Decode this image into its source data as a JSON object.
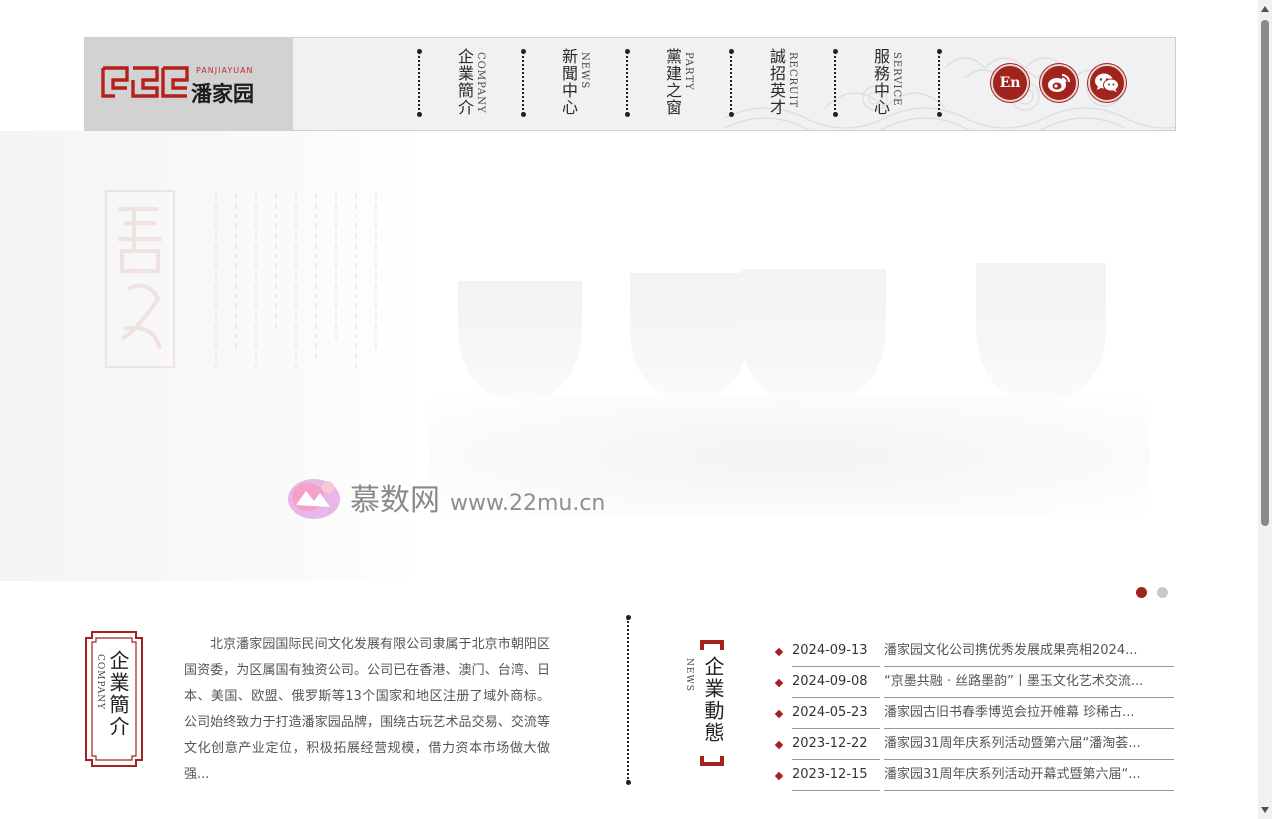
{
  "header": {
    "logo_text": "潘家园",
    "logo_sub": "PANJIAYUAN",
    "nav": [
      {
        "cn": "企業簡介",
        "en": "COMPANY"
      },
      {
        "cn": "新聞中心",
        "en": "NEWS"
      },
      {
        "cn": "黨建之窗",
        "en": "PARTY"
      },
      {
        "cn": "誠招英才",
        "en": "RECRUIT"
      },
      {
        "cn": "服務中心",
        "en": "SERVICE"
      }
    ],
    "lang_button": "En",
    "icons": [
      "weibo-icon",
      "wechat-icon"
    ]
  },
  "banner": {
    "watermark_text": "慕数网",
    "watermark_url": "www.22mu.cn",
    "slides_total": 2,
    "active_slide": 1
  },
  "company": {
    "title_cn": "企業簡介",
    "title_en": "COMPANY",
    "intro": "北京潘家园国际民间文化发展有限公司隶属于北京市朝阳区国资委，为区属国有独资公司。公司已在香港、澳门、台湾、日本、美国、欧盟、俄罗斯等13个国家和地区注册了域外商标。公司始终致力于打造潘家园品牌，围绕古玩艺术品交易、交流等文化创意产业定位，积极拓展经营规模，借力资本市场做大做强..."
  },
  "news": {
    "title_cn": "企業動態",
    "title_en": "NEWS",
    "items": [
      {
        "date": "2024-09-13",
        "title": "潘家园文化公司携优秀发展成果亮相2024..."
      },
      {
        "date": "2024-09-08",
        "title": "“京墨共融 · 丝路墨韵”丨墨玉文化艺术交流..."
      },
      {
        "date": "2024-05-23",
        "title": "潘家园古旧书春季博览会拉开帷幕 珍稀古..."
      },
      {
        "date": "2023-12-22",
        "title": "潘家园31周年庆系列活动暨第六届“潘淘荟..."
      },
      {
        "date": "2023-12-15",
        "title": "潘家园31周年庆系列活动开幕式暨第六届“..."
      }
    ]
  },
  "colors": {
    "accent": "#a0231e"
  }
}
